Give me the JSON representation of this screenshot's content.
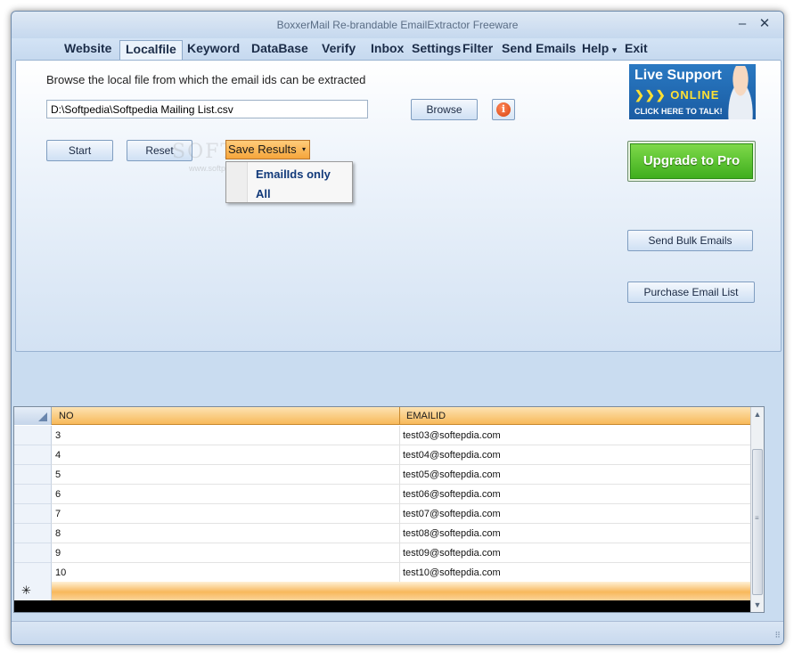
{
  "window": {
    "title": "BoxxerMail Re-brandable EmailExtractor Freeware",
    "minimize_glyph": "–",
    "close_glyph": "✕"
  },
  "menu": {
    "items": [
      "Website",
      "Localfile",
      "Keyword",
      "DataBase",
      "Verify",
      "Inbox",
      "Settings",
      "Filter",
      "Send Emails",
      "Help",
      "Exit"
    ],
    "active": "Localfile",
    "help_arrow": "▾"
  },
  "localfile": {
    "browse_label": "Browse the local file from which the email ids can be extracted",
    "file_path": "D:\\Softpedia\\Softpedia Mailing List.csv",
    "browse_button": "Browse",
    "start_button": "Start",
    "reset_button": "Reset",
    "save_results_button": "Save Results",
    "save_results_arrow": "▾",
    "save_options": [
      "EmailIds only",
      "All"
    ],
    "info_icon_glyph": "i"
  },
  "ads": {
    "live_support_title": "Live Support",
    "live_support_status": "❯❯❯ ONLINE",
    "live_support_cta": "CLICK HERE TO TALK!",
    "upgrade_button": "Upgrade to Pro",
    "send_bulk_button": "Send Bulk Emails",
    "purchase_list_button": "Purchase Email List"
  },
  "watermark": {
    "big": "SOFTPEDIA",
    "small": "www.softpedia.com"
  },
  "grid": {
    "columns": [
      "NO",
      "EMAILID"
    ],
    "rows": [
      {
        "no": "3",
        "email": "test03@softepdia.com"
      },
      {
        "no": "4",
        "email": "test04@softepdia.com"
      },
      {
        "no": "5",
        "email": "test05@softepdia.com"
      },
      {
        "no": "6",
        "email": "test06@softepdia.com"
      },
      {
        "no": "7",
        "email": "test07@softepdia.com"
      },
      {
        "no": "8",
        "email": "test08@softepdia.com"
      },
      {
        "no": "9",
        "email": "test09@softepdia.com"
      },
      {
        "no": "10",
        "email": "test10@softepdia.com"
      }
    ],
    "new_row_glyph": "✳",
    "scroll_up_glyph": "▲",
    "scroll_down_glyph": "▼",
    "scroll_grip_glyph": "≡"
  },
  "statusbar": {
    "grip_glyph": "⠿"
  },
  "colors": {
    "accent_orange": "#f6a53b",
    "upgrade_green": "#3fae1d",
    "window_blue": "#c9dcf0"
  }
}
